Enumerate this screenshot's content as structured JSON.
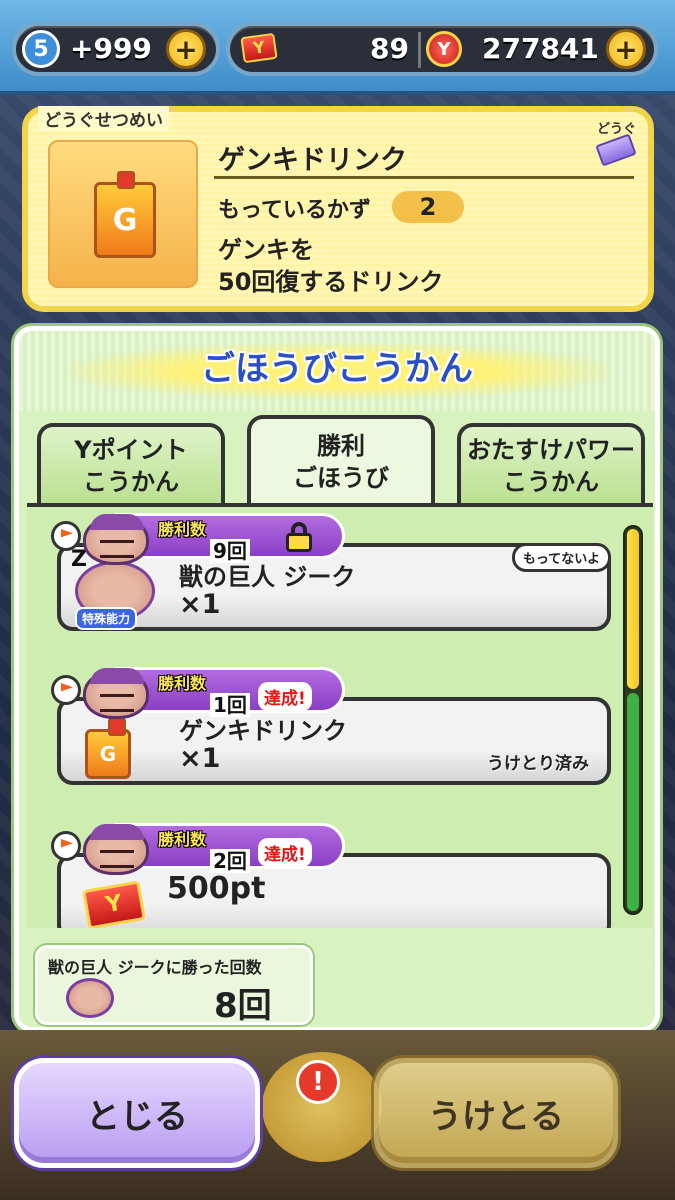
{
  "topbar": {
    "stamina_level": "5",
    "stamina_value": "+999",
    "ycard_count": "89",
    "money": "277841",
    "plus": "+"
  },
  "item_desc": {
    "header": "どうぐせつめい",
    "category": "どうぐ",
    "name": "ゲンキドリンク",
    "count_label": "もっているかず",
    "count": "2",
    "description": "ゲンキを\n50回復するドリンク",
    "item_letter": "G"
  },
  "reward_panel": {
    "title": "ごほうびこうかん",
    "tabs": [
      {
        "label": "Yポイント\nこうかん"
      },
      {
        "label": "勝利\nごほうび"
      },
      {
        "label": "おたすけパワー\nこうかん"
      }
    ],
    "active_tab": 1,
    "rewards": [
      {
        "wins_label": "勝利数",
        "wins_required": "9回",
        "status": "locked",
        "badge": "もってないよ",
        "name": "獣の巨人 ジーク",
        "qty": "×1",
        "special_tag": "特殊能力",
        "z_mark": "Z"
      },
      {
        "wins_label": "勝利数",
        "wins_required": "1回",
        "status_text": "達成!",
        "name": "ゲンキドリンク",
        "qty": "×1",
        "received": "うけとり済み",
        "item_letter": "G"
      },
      {
        "wins_label": "勝利数",
        "wins_required": "2回",
        "status_text": "達成!",
        "name": "500pt",
        "item_letter": "Y"
      }
    ],
    "win_count": {
      "label": "獣の巨人 ジークに勝った回数",
      "value": "8回"
    }
  },
  "buttons": {
    "close": "とじる",
    "receive": "うけとる",
    "alert": "!"
  },
  "colors": {
    "accent_title": "#2b4fc4",
    "achieved": "#e01818",
    "panel_green": "#d8f2c0",
    "panel_yellow": "#fff8c8"
  }
}
